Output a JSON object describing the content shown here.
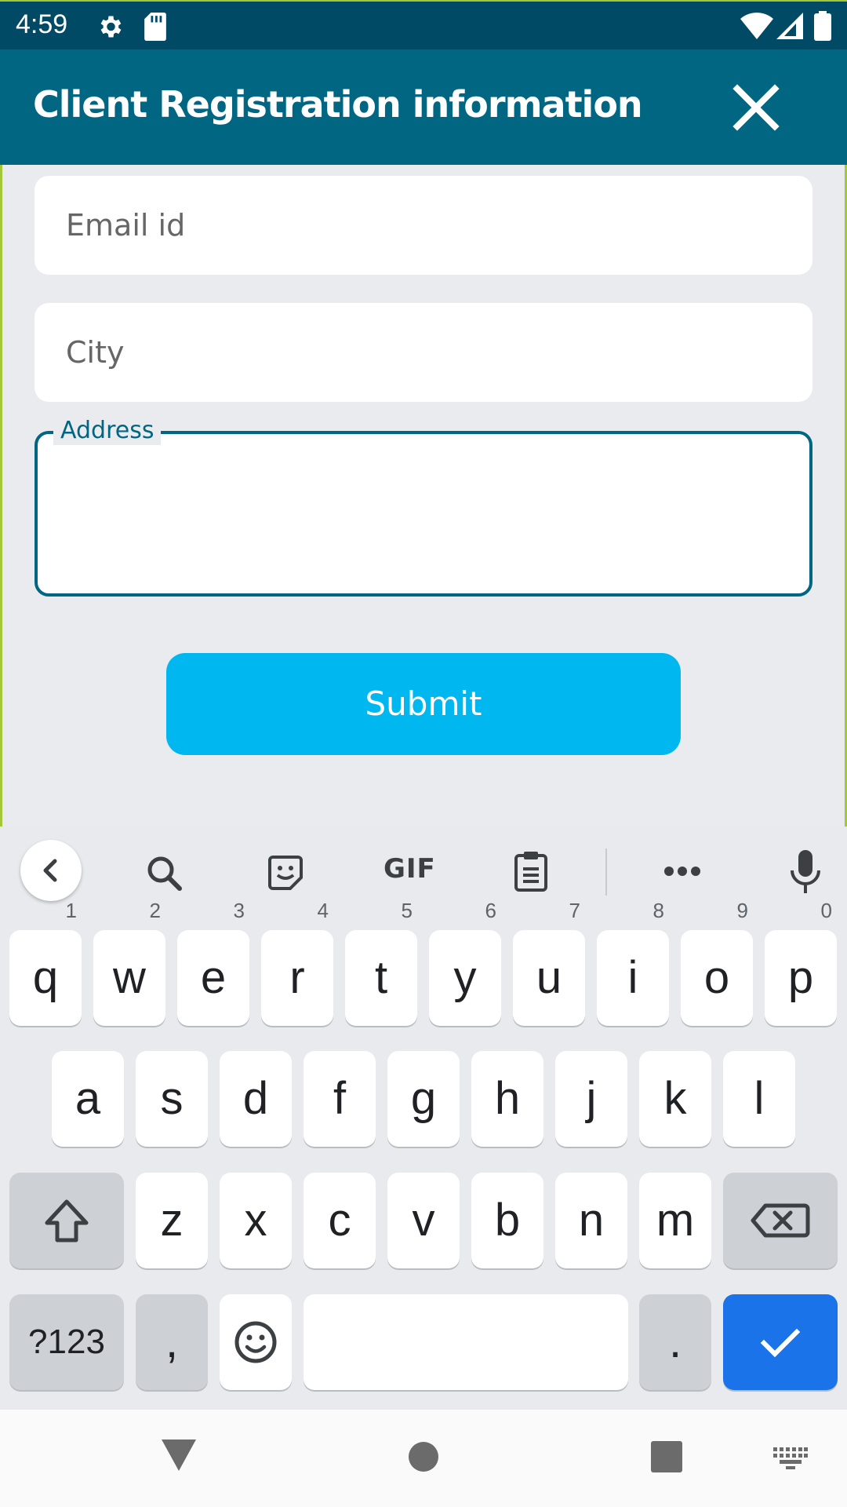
{
  "status_bar": {
    "time": "4:59",
    "icons": [
      "settings-icon",
      "sd-card-icon",
      "wifi-icon",
      "cellular-signal-icon",
      "battery-icon"
    ]
  },
  "app_bar": {
    "title": "Client Registration information",
    "close_icon": "close-icon"
  },
  "form": {
    "email_placeholder": "Email id",
    "city_placeholder": "City",
    "address_label": "Address",
    "address_value": "",
    "submit_label": "Submit"
  },
  "keyboard": {
    "toolbar_icons": [
      "chevron-left-icon",
      "search-icon",
      "sticker-icon",
      "gif-icon",
      "clipboard-icon",
      "more-icon",
      "microphone-icon"
    ],
    "gif_label": "GIF",
    "row1": [
      {
        "label": "q",
        "hint": "1"
      },
      {
        "label": "w",
        "hint": "2"
      },
      {
        "label": "e",
        "hint": "3"
      },
      {
        "label": "r",
        "hint": "4"
      },
      {
        "label": "t",
        "hint": "5"
      },
      {
        "label": "y",
        "hint": "6"
      },
      {
        "label": "u",
        "hint": "7"
      },
      {
        "label": "i",
        "hint": "8"
      },
      {
        "label": "o",
        "hint": "9"
      },
      {
        "label": "p",
        "hint": "0"
      }
    ],
    "row2": [
      "a",
      "s",
      "d",
      "f",
      "g",
      "h",
      "j",
      "k",
      "l"
    ],
    "row3": [
      "z",
      "x",
      "c",
      "v",
      "b",
      "n",
      "m"
    ],
    "symbols_label": "?123",
    "comma_label": ",",
    "period_label": ".",
    "space_label": ""
  },
  "colors": {
    "status_bar": "#004a66",
    "app_bar": "#006682",
    "submit": "#00b7ef",
    "enter_key": "#1a73e8",
    "frame_border": "#a4c639"
  }
}
